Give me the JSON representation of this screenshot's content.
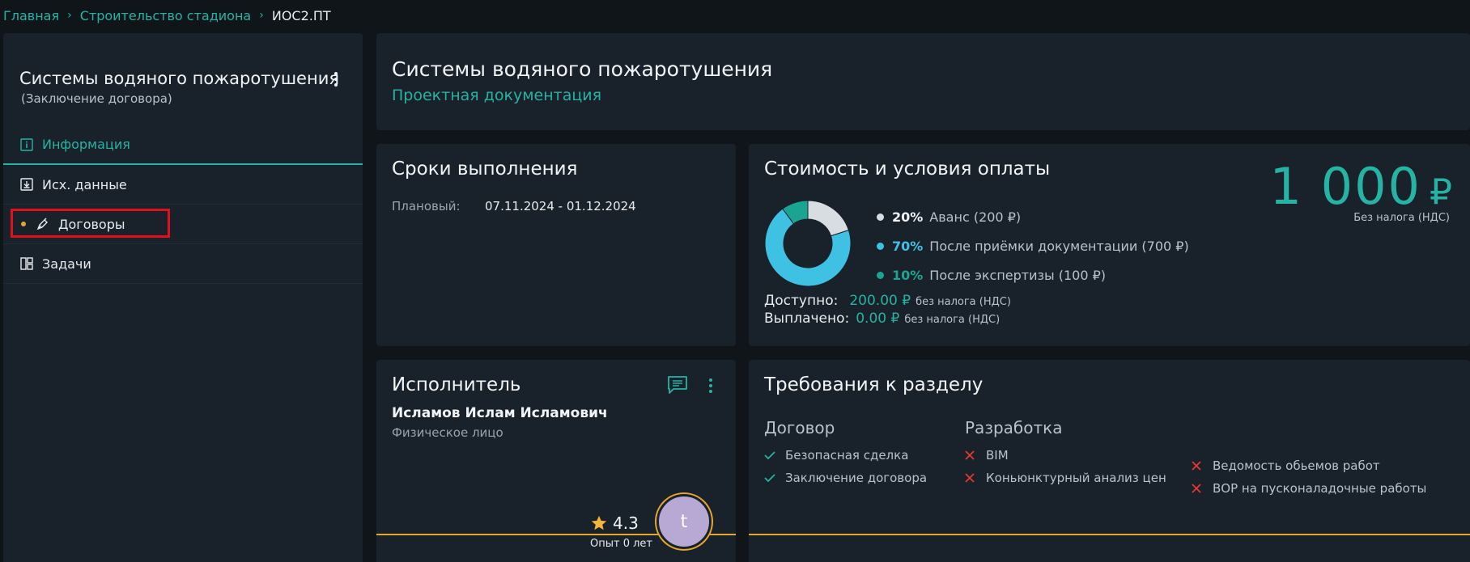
{
  "breadcrumb": {
    "items": [
      "Главная",
      "Строительство стадиона"
    ],
    "current": "ИОС2.ПТ"
  },
  "sidebar": {
    "title": "Системы водяного пожаротушения",
    "subtitle": "(Заключение договора)",
    "items": [
      {
        "label": "Информация",
        "icon": "info-icon",
        "active": true
      },
      {
        "label": "Исх. данные",
        "icon": "download-icon"
      },
      {
        "label": "Договоры",
        "icon": "pen-icon",
        "has_dot": true,
        "highlighted": true
      },
      {
        "label": "Задачи",
        "icon": "layout-icon"
      }
    ]
  },
  "header": {
    "title": "Системы водяного пожаротушения",
    "subtitle": "Проектная документация"
  },
  "deadline": {
    "title": "Сроки выполнения",
    "planned_label": "Плановый:",
    "planned_value": "07.11.2024 - 01.12.2024"
  },
  "cost": {
    "title": "Стоимость и условия оплаты",
    "total": "1 000",
    "currency": "₽",
    "total_note": "Без налога (НДС)",
    "payments": [
      {
        "percent": "20%",
        "value": 20,
        "desc": "Аванс (200 ₽)",
        "color": "#d8dde2"
      },
      {
        "percent": "70%",
        "value": 70,
        "desc": "После приёмки документации (700 ₽)",
        "color": "#3fc1e4"
      },
      {
        "percent": "10%",
        "value": 10,
        "desc": "После экспертизы (100 ₽)",
        "color": "#1aa593"
      }
    ],
    "available_label": "Доступно:",
    "available_value": "200.00 ₽",
    "paid_label": "Выплачено:",
    "paid_value": "0.00 ₽",
    "tax_note": "без налога (НДС)"
  },
  "executor": {
    "title": "Исполнитель",
    "name": "Исламов Ислам Исламович",
    "type": "Физическое лицо",
    "rating": "4.3",
    "experience": "Опыт 0 лет",
    "avatar_letter": "t"
  },
  "requirements": {
    "title": "Требования к разделу",
    "columns": [
      {
        "title": "Договор",
        "items": [
          {
            "label": "Безопасная сделка",
            "ok": true
          },
          {
            "label": "Заключение договора",
            "ok": true
          }
        ]
      },
      {
        "title": "Разработка",
        "items": [
          {
            "label": "BIM",
            "ok": false
          },
          {
            "label": "Коньюнктурный анализ цен",
            "ok": false
          }
        ]
      },
      {
        "title": "",
        "items": [
          {
            "label": "Ведомость обьемов работ",
            "ok": false
          },
          {
            "label": "ВОР на пусконаладочные работы",
            "ok": false
          }
        ]
      }
    ]
  },
  "colors": {
    "accent": "#26b3a3",
    "warning": "#e6a72d",
    "error": "#e53935",
    "panel": "#19212a",
    "background": "#10151a"
  }
}
